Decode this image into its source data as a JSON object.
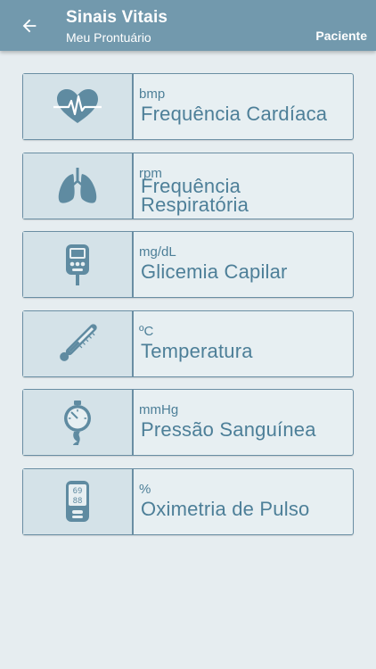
{
  "header": {
    "title": "Sinais Vitais",
    "subtitle": "Meu Prontuário",
    "action_label": "Paciente",
    "back_icon": "arrow-left-icon"
  },
  "vitals": [
    {
      "unit": "bmp",
      "label": "Frequência Cardíaca",
      "icon": "heart-pulse-icon"
    },
    {
      "unit": "rpm",
      "label": "Frequência Respiratória",
      "icon": "lungs-icon"
    },
    {
      "unit": "mg/dL",
      "label": "Glicemia Capilar",
      "icon": "glucometer-icon"
    },
    {
      "unit": "ºC",
      "label": "Temperatura",
      "icon": "thermometer-icon"
    },
    {
      "unit": "mmHg",
      "label": "Pressão Sanguínea",
      "icon": "blood-pressure-gauge-icon"
    },
    {
      "unit": "%",
      "label": "Oximetria de Pulso",
      "icon": "pulse-oximeter-icon"
    }
  ],
  "oximeter_display": [
    "69",
    "88"
  ],
  "colors": {
    "appbar": "#7299ad",
    "background": "#e6edf0",
    "card_border": "#6a8ea3",
    "icon_panel": "#d4e2e8",
    "text": "#4d7f98",
    "icon": "#5f8ba1"
  }
}
